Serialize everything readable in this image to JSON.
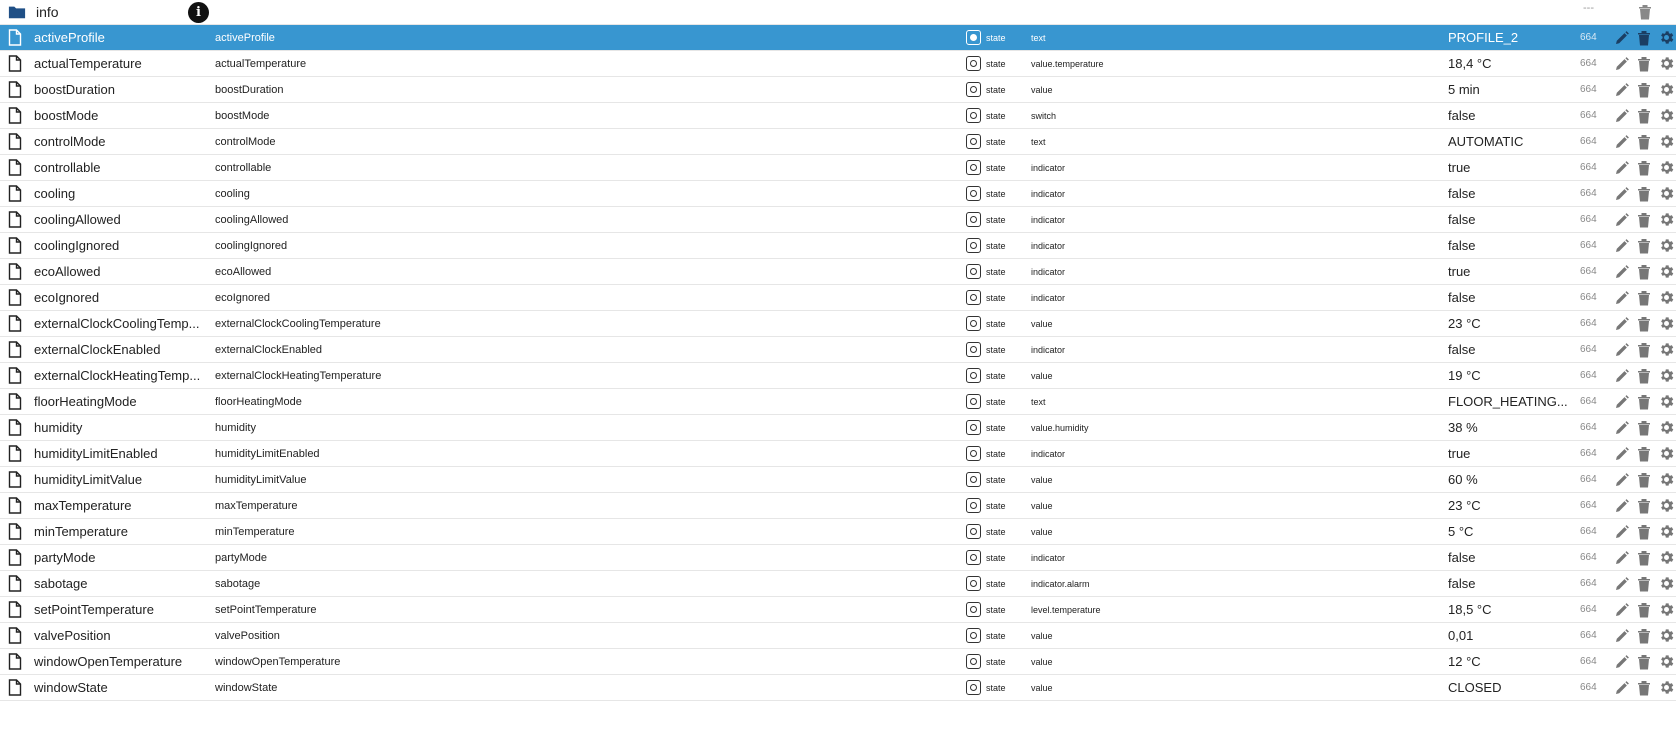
{
  "folder": {
    "label": "info",
    "icon": "folder-icon",
    "info_icon": "i",
    "acl": "---"
  },
  "colors": {
    "selected": "#3896d0",
    "icon_gray": "#666666"
  },
  "rows": [
    {
      "id": "activeProfile",
      "name": "activeProfile",
      "type": "state",
      "role": "text",
      "value": "PROFILE_2",
      "acl": "664",
      "selected": true
    },
    {
      "id": "actualTemperature",
      "name": "actualTemperature",
      "type": "state",
      "role": "value.temperature",
      "value": "18,4 °C",
      "acl": "664"
    },
    {
      "id": "boostDuration",
      "name": "boostDuration",
      "type": "state",
      "role": "value",
      "value": "5 min",
      "acl": "664"
    },
    {
      "id": "boostMode",
      "name": "boostMode",
      "type": "state",
      "role": "switch",
      "value": "false",
      "acl": "664"
    },
    {
      "id": "controlMode",
      "name": "controlMode",
      "type": "state",
      "role": "text",
      "value": "AUTOMATIC",
      "acl": "664"
    },
    {
      "id": "controllable",
      "name": "controllable",
      "type": "state",
      "role": "indicator",
      "value": "true",
      "acl": "664"
    },
    {
      "id": "cooling",
      "name": "cooling",
      "type": "state",
      "role": "indicator",
      "value": "false",
      "acl": "664"
    },
    {
      "id": "coolingAllowed",
      "name": "coolingAllowed",
      "type": "state",
      "role": "indicator",
      "value": "false",
      "acl": "664"
    },
    {
      "id": "coolingIgnored",
      "name": "coolingIgnored",
      "type": "state",
      "role": "indicator",
      "value": "false",
      "acl": "664"
    },
    {
      "id": "ecoAllowed",
      "name": "ecoAllowed",
      "type": "state",
      "role": "indicator",
      "value": "true",
      "acl": "664"
    },
    {
      "id": "ecoIgnored",
      "name": "ecoIgnored",
      "type": "state",
      "role": "indicator",
      "value": "false",
      "acl": "664"
    },
    {
      "id": "externalClockCoolingTemp...",
      "name": "externalClockCoolingTemperature",
      "type": "state",
      "role": "value",
      "value": "23 °C",
      "acl": "664"
    },
    {
      "id": "externalClockEnabled",
      "name": "externalClockEnabled",
      "type": "state",
      "role": "indicator",
      "value": "false",
      "acl": "664"
    },
    {
      "id": "externalClockHeatingTemp...",
      "name": "externalClockHeatingTemperature",
      "type": "state",
      "role": "value",
      "value": "19 °C",
      "acl": "664"
    },
    {
      "id": "floorHeatingMode",
      "name": "floorHeatingMode",
      "type": "state",
      "role": "text",
      "value": "FLOOR_HEATING...",
      "acl": "664"
    },
    {
      "id": "humidity",
      "name": "humidity",
      "type": "state",
      "role": "value.humidity",
      "value": "38 %",
      "acl": "664"
    },
    {
      "id": "humidityLimitEnabled",
      "name": "humidityLimitEnabled",
      "type": "state",
      "role": "indicator",
      "value": "true",
      "acl": "664"
    },
    {
      "id": "humidityLimitValue",
      "name": "humidityLimitValue",
      "type": "state",
      "role": "value",
      "value": "60 %",
      "acl": "664"
    },
    {
      "id": "maxTemperature",
      "name": "maxTemperature",
      "type": "state",
      "role": "value",
      "value": "23 °C",
      "acl": "664"
    },
    {
      "id": "minTemperature",
      "name": "minTemperature",
      "type": "state",
      "role": "value",
      "value": "5 °C",
      "acl": "664"
    },
    {
      "id": "partyMode",
      "name": "partyMode",
      "type": "state",
      "role": "indicator",
      "value": "false",
      "acl": "664"
    },
    {
      "id": "sabotage",
      "name": "sabotage",
      "type": "state",
      "role": "indicator.alarm",
      "value": "false",
      "acl": "664"
    },
    {
      "id": "setPointTemperature",
      "name": "setPointTemperature",
      "type": "state",
      "role": "level.temperature",
      "value": "18,5 °C",
      "acl": "664"
    },
    {
      "id": "valvePosition",
      "name": "valvePosition",
      "type": "state",
      "role": "value",
      "value": "0,01",
      "acl": "664"
    },
    {
      "id": "windowOpenTemperature",
      "name": "windowOpenTemperature",
      "type": "state",
      "role": "value",
      "value": "12 °C",
      "acl": "664"
    },
    {
      "id": "windowState",
      "name": "windowState",
      "type": "state",
      "role": "value",
      "value": "CLOSED",
      "acl": "664"
    }
  ]
}
